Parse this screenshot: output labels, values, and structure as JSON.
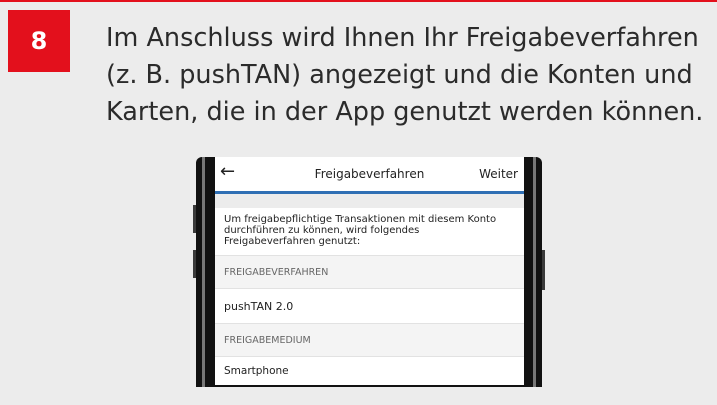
{
  "step": {
    "number": "8"
  },
  "headline": {
    "line1": "Im Anschluss wird Ihnen Ihr Freigabeverfahren",
    "line2": "(z. B. pushTAN) angezeigt und die Konten und",
    "line3": "Karten, die in der App genutzt werden können."
  },
  "screen": {
    "nav": {
      "back_icon": "←",
      "title": "Freigabeverfahren",
      "next_label": "Weiter"
    },
    "intro": {
      "line1": "Um freigabepflichtige Transaktionen mit diesem Konto",
      "line2": "durchführen zu können, wird folgendes",
      "line3": "Freigabeverfahren genutzt:"
    },
    "section1_header": "FREIGABEVERFAHREN",
    "section1_value": "pushTAN 2.0",
    "section2_header": "FREIGABEMEDIUM",
    "section2_value": "Smartphone"
  },
  "colors": {
    "accent_red": "#e3101c",
    "nav_blue": "#2f6fb4",
    "background": "#ececec"
  }
}
